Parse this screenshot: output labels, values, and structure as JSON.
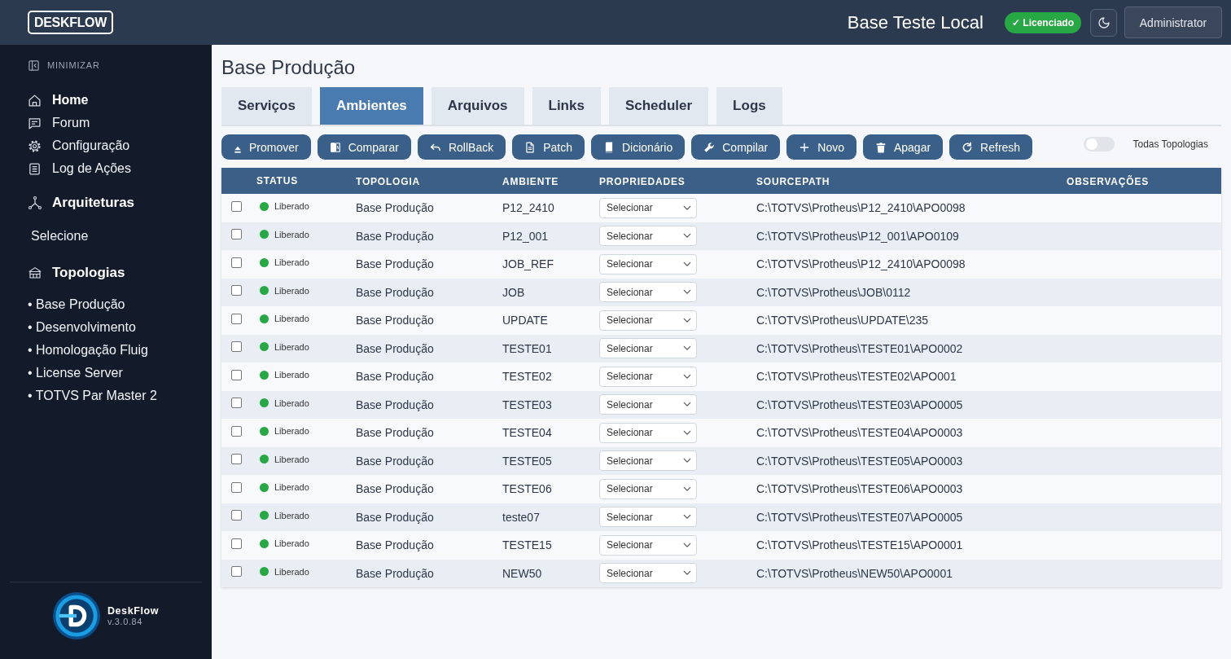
{
  "header": {
    "logo": "DESKFLOW",
    "title": "Base Teste Local",
    "badge": "✓ Licenciado",
    "user": "Administrator"
  },
  "sidebar": {
    "minimize": "MINIMIZAR",
    "nav": [
      {
        "label": "Home",
        "kind": "heading"
      },
      {
        "label": "Forum",
        "kind": "link"
      },
      {
        "label": "Configuração",
        "kind": "link"
      },
      {
        "label": "Log de Ações",
        "kind": "link"
      }
    ],
    "architectures": {
      "title": "Arquiteturas",
      "selector": "Selecione"
    },
    "topologies": {
      "title": "Topologias",
      "items": [
        "• Base Produção",
        "• Desenvolvimento",
        "• Homologação Fluig",
        "• License Server",
        "• TOTVS Par Master 2"
      ]
    },
    "footer": {
      "name": "DeskFlow",
      "version": "v.3.0.84"
    }
  },
  "page": {
    "title": "Base Produção"
  },
  "tabs": [
    {
      "label": "Serviços",
      "selected": false
    },
    {
      "label": "Ambientes",
      "selected": true
    },
    {
      "label": "Arquivos",
      "selected": false
    },
    {
      "label": "Links",
      "selected": false
    },
    {
      "label": "Scheduler",
      "selected": false
    },
    {
      "label": "Logs",
      "selected": false
    }
  ],
  "toolbar": {
    "buttons": [
      "Promover",
      "Comparar",
      "RollBack",
      "Patch",
      "Dicionário",
      "Compilar",
      "Novo",
      "Apagar",
      "Refresh"
    ],
    "toggle": {
      "label": "Todas Topologias",
      "on": false
    }
  },
  "table": {
    "columns": [
      "STATUS",
      "TOPOLOGIA",
      "AMBIENTE",
      "PROPRIEDADES",
      "SOURCEPATH",
      "OBSERVAÇÕES"
    ],
    "rows": [
      {
        "checked": false,
        "status": "Liberado",
        "color": "#28a745",
        "topologia": "Base Produção",
        "ambiente": "P12_2410",
        "propriedades": "Selecionar",
        "sourcepath": "C:\\TOTVS\\Protheus\\P12_2410\\APO0098"
      },
      {
        "checked": false,
        "status": "Liberado",
        "color": "#28a745",
        "topologia": "Base Produção",
        "ambiente": "P12_001",
        "propriedades": "Selecionar",
        "sourcepath": "C:\\TOTVS\\Protheus\\P12_001\\APO0109"
      },
      {
        "checked": false,
        "status": "Liberado",
        "color": "#28a745",
        "topologia": "Base Produção",
        "ambiente": "JOB_REF",
        "propriedades": "Selecionar",
        "sourcepath": "C:\\TOTVS\\Protheus\\P12_2410\\APO0098"
      },
      {
        "checked": false,
        "status": "Liberado",
        "color": "#28a745",
        "topologia": "Base Produção",
        "ambiente": "JOB",
        "propriedades": "Selecionar",
        "sourcepath": "C:\\TOTVS\\Protheus\\JOB\\0112"
      },
      {
        "checked": false,
        "status": "Liberado",
        "color": "#28a745",
        "topologia": "Base Produção",
        "ambiente": "UPDATE",
        "propriedades": "Selecionar",
        "sourcepath": "C:\\TOTVS\\Protheus\\UPDATE\\235"
      },
      {
        "checked": false,
        "status": "Liberado",
        "color": "#28a745",
        "topologia": "Base Produção",
        "ambiente": "TESTE01",
        "propriedades": "Selecionar",
        "sourcepath": "C:\\TOTVS\\Protheus\\TESTE01\\APO0002"
      },
      {
        "checked": false,
        "status": "Liberado",
        "color": "#28a745",
        "topologia": "Base Produção",
        "ambiente": "TESTE02",
        "propriedades": "Selecionar",
        "sourcepath": "C:\\TOTVS\\Protheus\\TESTE02\\APO001"
      },
      {
        "checked": false,
        "status": "Liberado",
        "color": "#28a745",
        "topologia": "Base Produção",
        "ambiente": "TESTE03",
        "propriedades": "Selecionar",
        "sourcepath": "C:\\TOTVS\\Protheus\\TESTE03\\APO0005"
      },
      {
        "checked": false,
        "status": "Liberado",
        "color": "#28a745",
        "topologia": "Base Produção",
        "ambiente": "TESTE04",
        "propriedades": "Selecionar",
        "sourcepath": "C:\\TOTVS\\Protheus\\TESTE04\\APO0003"
      },
      {
        "checked": false,
        "status": "Liberado",
        "color": "#28a745",
        "topologia": "Base Produção",
        "ambiente": "TESTE05",
        "propriedades": "Selecionar",
        "sourcepath": "C:\\TOTVS\\Protheus\\TESTE05\\APO0003"
      },
      {
        "checked": false,
        "status": "Liberado",
        "color": "#28a745",
        "topologia": "Base Produção",
        "ambiente": "TESTE06",
        "propriedades": "Selecionar",
        "sourcepath": "C:\\TOTVS\\Protheus\\TESTE06\\APO0003"
      },
      {
        "checked": false,
        "status": "Liberado",
        "color": "#28a745",
        "topologia": "Base Produção",
        "ambiente": "teste07",
        "propriedades": "Selecionar",
        "sourcepath": "C:\\TOTVS\\Protheus\\TESTE07\\APO0005"
      },
      {
        "checked": false,
        "status": "Liberado",
        "color": "#28a745",
        "topologia": "Base Produção",
        "ambiente": "TESTE15",
        "propriedades": "Selecionar",
        "sourcepath": "C:\\TOTVS\\Protheus\\TESTE15\\APO0001"
      },
      {
        "checked": false,
        "status": "Liberado",
        "color": "#28a745",
        "topologia": "Base Produção",
        "ambiente": "NEW50",
        "propriedades": "Selecionar",
        "sourcepath": "C:\\TOTVS\\Protheus\\NEW50\\APO0001"
      }
    ]
  }
}
